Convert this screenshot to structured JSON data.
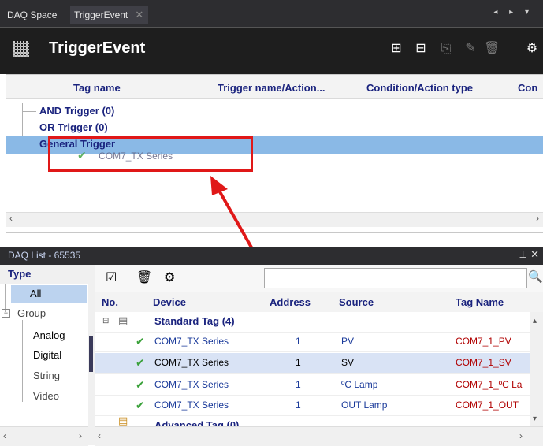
{
  "tabs": {
    "daq_space": "DAQ Space",
    "trigger_event": "TriggerEvent",
    "close_glyph": "✕",
    "nav": "◂ ▸ ▾"
  },
  "title": {
    "text": "TriggerEvent",
    "toolbar": [
      "⊞",
      "⊟",
      "⎘",
      "✎",
      "🗑",
      "⚙"
    ]
  },
  "trigger_grid": {
    "columns": [
      "Tag name",
      "Trigger name/Action...",
      "Condition/Action type",
      "Con"
    ],
    "rows": [
      "AND Trigger (0)",
      "OR Trigger (0)",
      "General Trigger"
    ],
    "drag_item": "COM7_TX Series"
  },
  "daq_list": {
    "title": "DAQ List - 65535",
    "pin": "ᵖ",
    "close": "✕",
    "type_header": "Type",
    "types": [
      "All",
      "Group",
      "Analog",
      "Digital",
      "String",
      "Video"
    ],
    "columns": [
      "No.",
      "Device",
      "Address",
      "Source",
      "Tag Name"
    ],
    "group_label": "Standard Tag (4)",
    "rows": [
      {
        "device": "COM7_TX Series",
        "address": "1",
        "source": "PV",
        "tag": "COM7_1_PV"
      },
      {
        "device": "COM7_TX Series",
        "address": "1",
        "source": "SV",
        "tag": "COM7_1_SV"
      },
      {
        "device": "COM7_TX Series",
        "address": "1",
        "source": "ºC Lamp",
        "tag": "COM7_1_ºC La"
      },
      {
        "device": "COM7_TX Series",
        "address": "1",
        "source": "OUT Lamp",
        "tag": "COM7_1_OUT"
      }
    ],
    "next_group_label": "Advanced Tag (0)"
  },
  "colors": {
    "highlight": "#8ab9e6",
    "annotation": "#e01818",
    "check": "#3aa13a"
  }
}
